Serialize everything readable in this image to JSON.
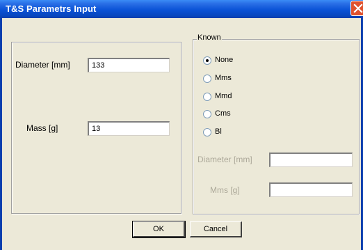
{
  "window": {
    "title": "T&S Parametrs Input"
  },
  "left_panel": {
    "diameter": {
      "label": "Diameter [mm]",
      "value": "133"
    },
    "mass": {
      "label": "Mass [g]",
      "value": "13"
    }
  },
  "known_group": {
    "title": "Known",
    "options": [
      {
        "label": "None",
        "selected": true
      },
      {
        "label": "Mms",
        "selected": false
      },
      {
        "label": "Mmd",
        "selected": false
      },
      {
        "label": "Cms",
        "selected": false
      },
      {
        "label": "Bl",
        "selected": false
      }
    ],
    "diameter": {
      "label": "Diameter [mm]",
      "value": ""
    },
    "mms": {
      "label": "Mms [g]",
      "value": ""
    }
  },
  "buttons": {
    "ok": "OK",
    "cancel": "Cancel"
  }
}
